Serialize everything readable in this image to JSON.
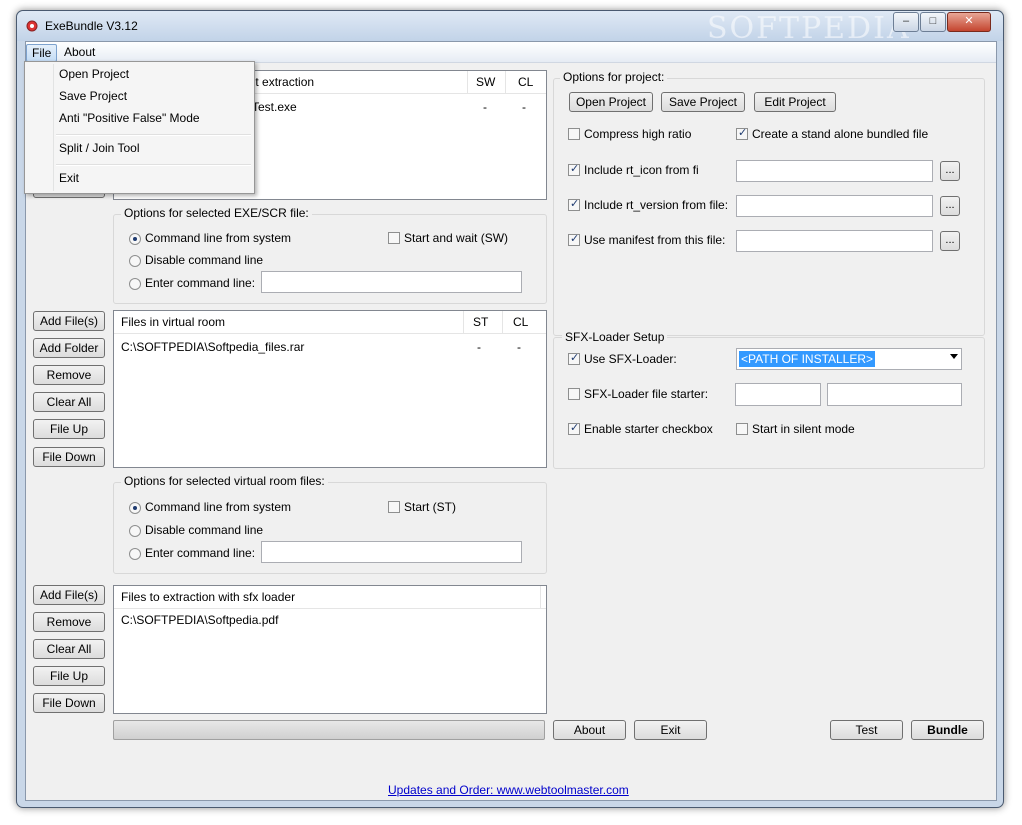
{
  "window": {
    "title": "ExeBundle V3.12",
    "watermark": "SOFTPEDIA",
    "min": "–",
    "max": "□",
    "close": "✕"
  },
  "menubar": {
    "file": "File",
    "about": "About",
    "watermark": "Softpedia"
  },
  "file_menu": {
    "items": [
      "Open Project",
      "Save Project",
      "Anti \"Positive False\" Mode",
      "Split / Join Tool",
      "Exit"
    ]
  },
  "top_list": {
    "columns": [
      "out extraction",
      "SW",
      "CL"
    ],
    "rows": [
      {
        "name": "Test.exe",
        "sw": "-",
        "cl": "-"
      }
    ],
    "side_button_partial": "File Down"
  },
  "exe_options": {
    "title": "Options for selected EXE/SCR file:",
    "radio_cmd_system": "Command line from system",
    "radio_disable": "Disable command line",
    "radio_enter": "Enter command line:",
    "check_start_wait": "Start and wait (SW)"
  },
  "virtual_room": {
    "buttons": [
      "Add File(s)",
      "Add Folder",
      "Remove",
      "Clear All",
      "File Up",
      "File Down"
    ],
    "columns": [
      "Files in virtual room",
      "ST",
      "CL"
    ],
    "rows": [
      {
        "name": "C:\\SOFTPEDIA\\Softpedia_files.rar",
        "st": "-",
        "cl": "-"
      }
    ]
  },
  "vr_options": {
    "title": "Options for selected virtual room files:",
    "radio_cmd_system": "Command line from system",
    "radio_disable": "Disable command line",
    "radio_enter": "Enter command line:",
    "check_start": "Start (ST)"
  },
  "sfx_list": {
    "buttons": [
      "Add File(s)",
      "Remove",
      "Clear All",
      "File Up",
      "File Down"
    ],
    "column": "Files to extraction with sfx loader",
    "rows": [
      "C:\\SOFTPEDIA\\Softpedia.pdf"
    ]
  },
  "project_options": {
    "title": "Options for project:",
    "open": "Open Project",
    "save": "Save Project",
    "edit": "Edit Project",
    "compress": "Compress high ratio",
    "standalone": "Create a stand alone bundled file",
    "rt_icon": "Include rt_icon from fi",
    "rt_version": "Include rt_version from file:",
    "manifest": "Use manifest from this file:",
    "browse": "..."
  },
  "sfx_setup": {
    "title": "SFX-Loader Setup",
    "use_sfx": "Use SFX-Loader:",
    "path_value": "<PATH OF INSTALLER>",
    "file_starter": "SFX-Loader file starter:",
    "enable_starter": "Enable starter checkbox",
    "silent": "Start in silent mode"
  },
  "bottom": {
    "about": "About",
    "exit": "Exit",
    "test": "Test",
    "bundle": "Bundle",
    "link": "Updates and Order: www.webtoolmaster.com"
  },
  "colors": {
    "selection": "#3399ff",
    "link": "#0000cc",
    "frame": "#c9d7e8"
  }
}
